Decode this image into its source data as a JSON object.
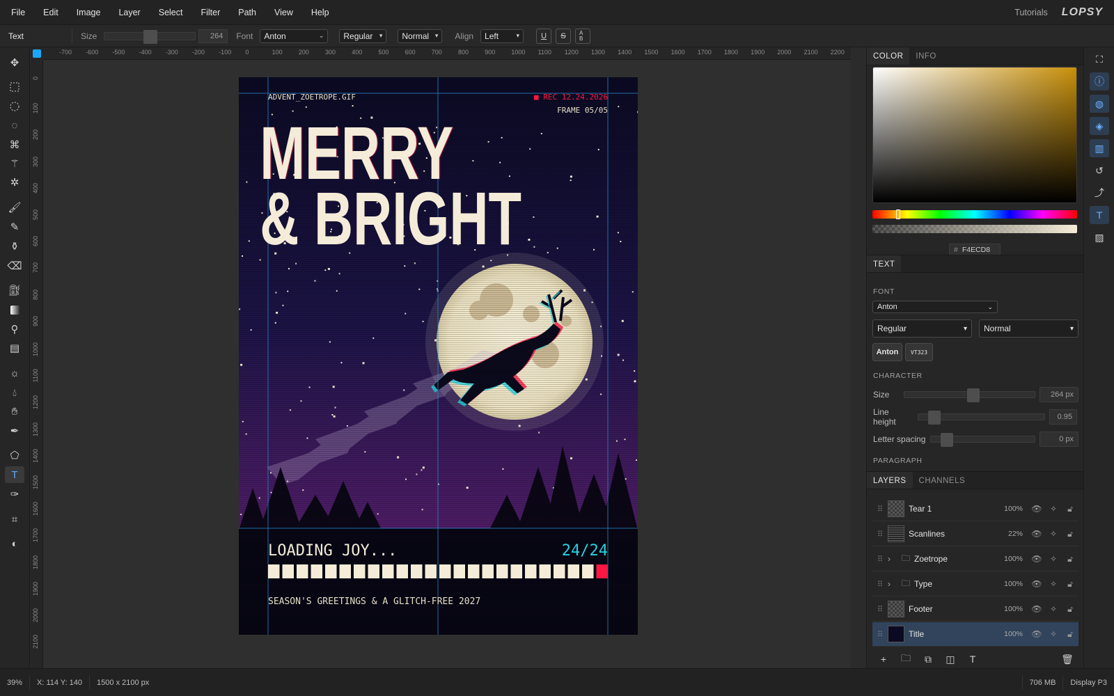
{
  "menu": [
    "File",
    "Edit",
    "Image",
    "Layer",
    "Select",
    "Filter",
    "Path",
    "View",
    "Help"
  ],
  "header": {
    "tutorials": "Tutorials",
    "brand": "LOPSY"
  },
  "options": {
    "tool_name": "Text",
    "size_label": "Size",
    "size_value": "264",
    "font_label": "Font",
    "font_value": "Anton",
    "style_value": "Regular",
    "weight_value": "Normal",
    "align_label": "Align",
    "align_value": "Left",
    "underline": "U",
    "strike": "S",
    "case": "AB"
  },
  "tools": [
    "move-icon",
    "rect-select-icon",
    "ellipse-select-icon",
    "lasso-icon",
    "quick-select-icon",
    "magic-wand-icon",
    "heal-icon",
    "brush-icon",
    "pencil-icon",
    "clone-icon",
    "eraser-icon",
    "bucket-icon",
    "gradient-icon",
    "stamp-icon",
    "pattern-icon",
    "dodge-icon",
    "blur-icon",
    "hand-icon",
    "eyedropper-icon",
    "shape-icon",
    "text-icon",
    "pen-icon",
    "crop-icon",
    "contrast-icon"
  ],
  "rulers": {
    "h": [
      "-700",
      "-600",
      "-500",
      "-400",
      "-300",
      "-200",
      "-100",
      "0",
      "100",
      "200",
      "300",
      "400",
      "500",
      "600",
      "700",
      "800",
      "900",
      "1000",
      "1100",
      "1200",
      "1300",
      "1400",
      "1500",
      "1600",
      "1700",
      "1800",
      "1900",
      "2000",
      "2100",
      "2200"
    ],
    "v": [
      "0",
      "100",
      "200",
      "300",
      "400",
      "500",
      "600",
      "700",
      "800",
      "900",
      "1000",
      "1100",
      "1200",
      "1300",
      "1400",
      "1500",
      "1600",
      "1700",
      "1800",
      "1900",
      "2000",
      "2100"
    ]
  },
  "document": {
    "filename": "ADVENT_ZOETROPE.GIF",
    "rec": "■ REC 12.24.2026",
    "frame": "FRAME 05/05",
    "title1": "MERRY",
    "title2": "& BRIGHT",
    "loading": "LOADING JOY...",
    "counter": "24/24",
    "progress": 1.0,
    "progress_cells": 24,
    "greeting": "SEASON'S GREETINGS & A GLITCH-FREE 2027",
    "colors": {
      "bg_top": "#0b0a22",
      "bg_bottom": "#5a1a66",
      "cream": "#f4ecd8",
      "accent_red": "#ff1744",
      "accent_cyan": "#27d3e0"
    }
  },
  "color_panel": {
    "tabs": [
      "COLOR",
      "INFO"
    ],
    "hex_label": "#",
    "hex_value": "F4ECD8"
  },
  "text_panel": {
    "tab": "TEXT",
    "font_header": "FONT",
    "font_value": "Anton",
    "style_value": "Regular",
    "weight_value": "Normal",
    "chips": [
      "Anton",
      "VT323"
    ],
    "character_header": "CHARACTER",
    "size_label": "Size",
    "size_value": "264 px",
    "lh_label": "Line height",
    "lh_value": "0.95",
    "ls_label": "Letter spacing",
    "ls_value": "0 px",
    "paragraph_header": "PARAGRAPH"
  },
  "layers_panel": {
    "tabs": [
      "LAYERS",
      "CHANNELS"
    ],
    "layers": [
      {
        "name": "Tear 1",
        "opacity": "100%"
      },
      {
        "name": "Scanlines",
        "opacity": "22%"
      },
      {
        "name": "Zoetrope",
        "opacity": "100%"
      },
      {
        "name": "Type",
        "opacity": "100%"
      },
      {
        "name": "Footer",
        "opacity": "100%"
      },
      {
        "name": "Title",
        "opacity": "100%"
      }
    ]
  },
  "status": {
    "zoom": "39%",
    "coords": "X: 114  Y: 140",
    "dims": "1500 x 2100 px",
    "memory": "706 MB",
    "profile": "Display P3"
  }
}
